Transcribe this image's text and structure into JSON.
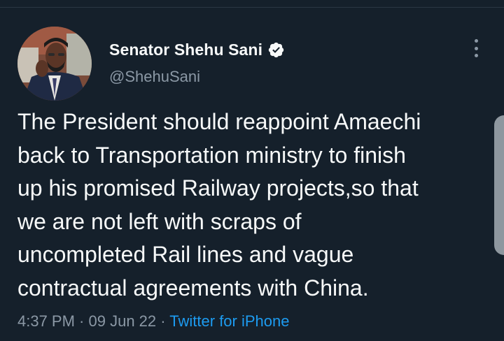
{
  "tweet": {
    "display_name": "Senator Shehu Sani",
    "handle": "@ShehuSani",
    "verified_icon": "verified-badge-icon",
    "more_icon": "more-options-icon",
    "body_lines": [
      "The President should reappoint Amaechi",
      "back to Transportation ministry to finish",
      "up his promised Railway projects,so that",
      "we are not left with scraps of",
      "uncompleted Rail lines and vague",
      "contractual agreements with China."
    ],
    "time": "4:37 PM",
    "separator": " · ",
    "date": "09 Jun 22",
    "source": "Twitter for iPhone"
  },
  "colors": {
    "background": "#15202b",
    "primary_text": "#f7f9f9",
    "secondary_text": "#8b98a5",
    "link": "#1d9bf0"
  }
}
